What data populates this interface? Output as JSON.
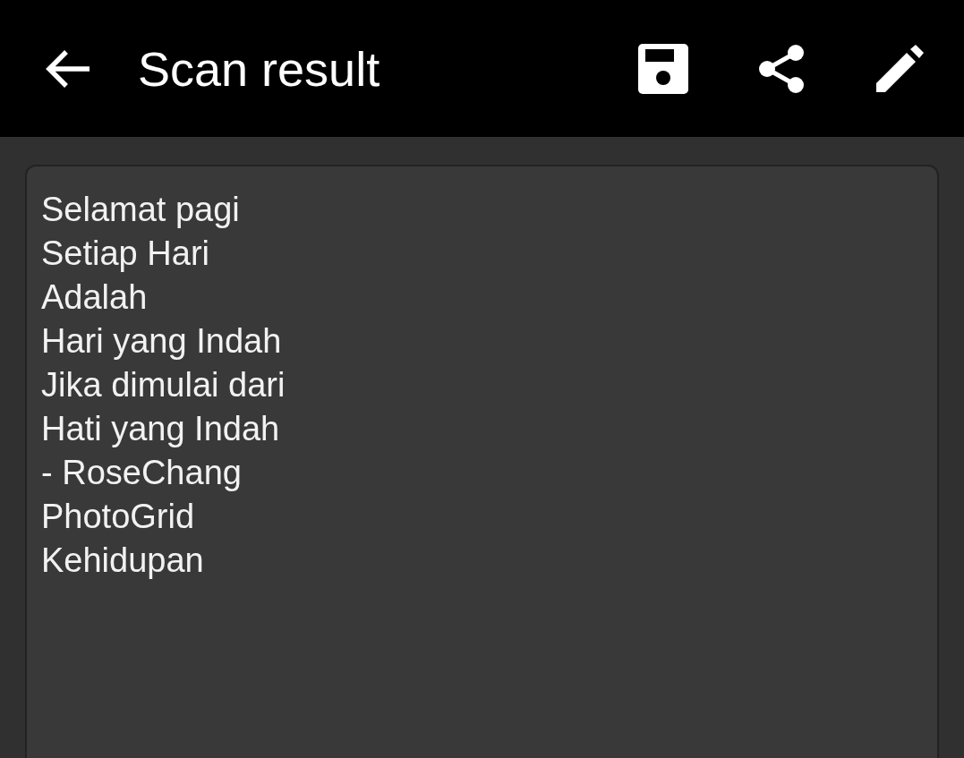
{
  "app_bar": {
    "title": "Scan result",
    "actions": [
      {
        "kind": "save"
      },
      {
        "kind": "share"
      },
      {
        "kind": "edit"
      }
    ]
  },
  "result": {
    "lines": [
      "Selamat pagi",
      "Setiap Hari",
      "Adalah",
      "Hari yang Indah",
      "Jika dimulai dari",
      "Hati yang Indah",
      "- RoseChang",
      "PhotoGrid",
      "Kehidupan"
    ]
  }
}
